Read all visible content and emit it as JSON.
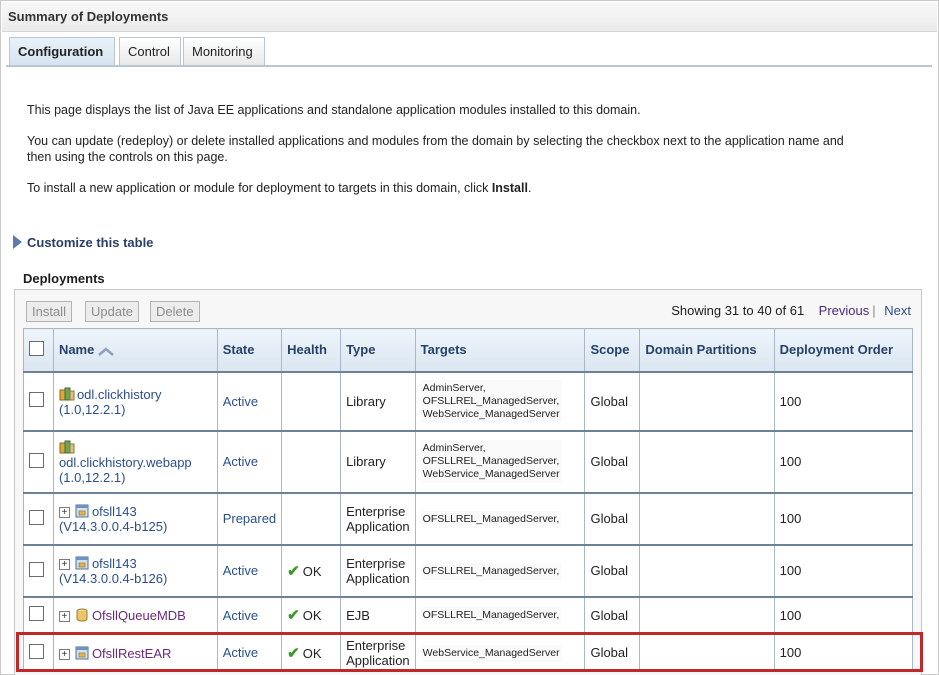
{
  "page": {
    "title": "Summary of Deployments",
    "tabs": [
      {
        "label": "Configuration",
        "active": true
      },
      {
        "label": "Control",
        "active": false
      },
      {
        "label": "Monitoring",
        "active": false
      }
    ],
    "description": {
      "line1": "This page displays the list of Java EE applications and standalone application modules installed to this domain.",
      "line2a": "You can update (redeploy) or delete installed applications and modules from the domain by selecting the checkbox next to the application name and",
      "line2b": "then using the controls on this page.",
      "line3_prefix": "To install a new application or module for deployment to targets in this domain, click ",
      "line3_bold": "Install",
      "line3_suffix": "."
    },
    "customize_label": "Customize this table",
    "deployments_label": "Deployments"
  },
  "toolbar": {
    "install_label": "Install",
    "update_label": "Update",
    "delete_label": "Delete",
    "showing_text": "Showing 31 to 40 of 61",
    "previous_label": "Previous",
    "next_label": "Next"
  },
  "table": {
    "columns": {
      "name": "Name",
      "state": "State",
      "health": "Health",
      "type": "Type",
      "targets": "Targets",
      "scope": "Scope",
      "domain_partitions": "Domain Partitions",
      "deployment_order": "Deployment Order"
    },
    "rows": [
      {
        "name_line1": "odl.clickhistory",
        "name_line2": "(1.0,12.2.1)",
        "state": "Active",
        "health": "",
        "type_line1": "Library",
        "type_line2": "",
        "targets_line1": "AdminServer,",
        "targets_line2": "OFSLLREL_ManagedServer,",
        "targets_line3": "WebService_ManagedServer",
        "scope": "Global",
        "domain_partitions": "",
        "deployment_order": "100"
      },
      {
        "name_line1": "odl.clickhistory.webapp",
        "name_line2": "(1.0,12.2.1)",
        "state": "Active",
        "health": "",
        "type_line1": "Library",
        "type_line2": "",
        "targets_line1": "AdminServer,",
        "targets_line2": "OFSLLREL_ManagedServer,",
        "targets_line3": "WebService_ManagedServer",
        "scope": "Global",
        "domain_partitions": "",
        "deployment_order": "100"
      },
      {
        "name_line1": "ofsll143",
        "name_line2": "(V14.3.0.0.4-b125)",
        "state": "Prepared",
        "health": "",
        "type_line1": "Enterprise",
        "type_line2": "Application",
        "targets_line1": "OFSLLREL_ManagedServer,",
        "scope": "Global",
        "domain_partitions": "",
        "deployment_order": "100"
      },
      {
        "name_line1": "ofsll143",
        "name_line2": "(V14.3.0.0.4-b126)",
        "state": "Active",
        "health": "OK",
        "type_line1": "Enterprise",
        "type_line2": "Application",
        "targets_line1": "OFSLLREL_ManagedServer,",
        "scope": "Global",
        "domain_partitions": "",
        "deployment_order": "100"
      },
      {
        "name_line1": "OfsllQueueMDB",
        "state": "Active",
        "health": "OK",
        "type_line1": "EJB",
        "targets_line1": "OFSLLREL_ManagedServer,",
        "scope": "Global",
        "domain_partitions": "",
        "deployment_order": "100"
      },
      {
        "name_line1": "OfsllRestEAR",
        "state": "Active",
        "health": "OK",
        "type_line1": "Enterprise",
        "type_line2": "Application",
        "targets_line1": "WebService_ManagedServer",
        "scope": "Global",
        "domain_partitions": "",
        "deployment_order": "100"
      }
    ]
  },
  "colors": {
    "link_blue": "#2a4f8f",
    "link_purple": "#6a2a7a",
    "header_text": "#26416b",
    "highlight_red": "#c0282a",
    "ok_green": "#3c9a2c"
  },
  "icons": {
    "library": "library-icon",
    "ear": "enterprise-app-icon",
    "ejb": "ejb-icon",
    "ok": "check-icon",
    "sort": "sort-icon",
    "expand": "expand-plus-icon"
  }
}
